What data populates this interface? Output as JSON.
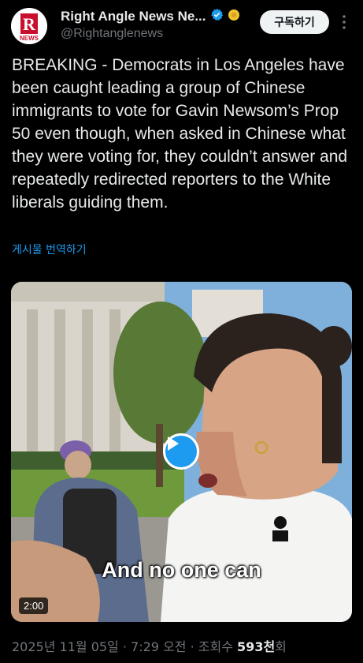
{
  "account": {
    "display_name": "Right Angle News Ne...",
    "handle": "@Rightanglenews",
    "logo_letter": "R",
    "logo_text": "NEWS"
  },
  "subscribe_label": "구독하기",
  "post": {
    "text": "BREAKING - Democrats in Los Angeles have been caught leading a group of Chinese immigrants to vote for Gavin Newsom’s Prop 50 even though, when asked in Chinese what they were voting for, they couldn’t answer and repeatedly redirected reporters to the White liberals guiding them.",
    "translate_label": "게시물 번역하기"
  },
  "video": {
    "caption": "And no one can",
    "duration": "2:00"
  },
  "meta": {
    "date": "2025년 11월 05일",
    "time": "7:29 오전",
    "views_label": "조회수",
    "views_value": "593천",
    "views_suffix": "회"
  },
  "colors": {
    "background": "#000000",
    "accent": "#1d9bf0",
    "verified": "#1d9bf0",
    "gold_badge": "#f4c430",
    "secondary_text": "#71767b"
  },
  "icons": [
    "verified-badge-icon",
    "gold-badge-icon",
    "more-icon",
    "play-icon"
  ]
}
